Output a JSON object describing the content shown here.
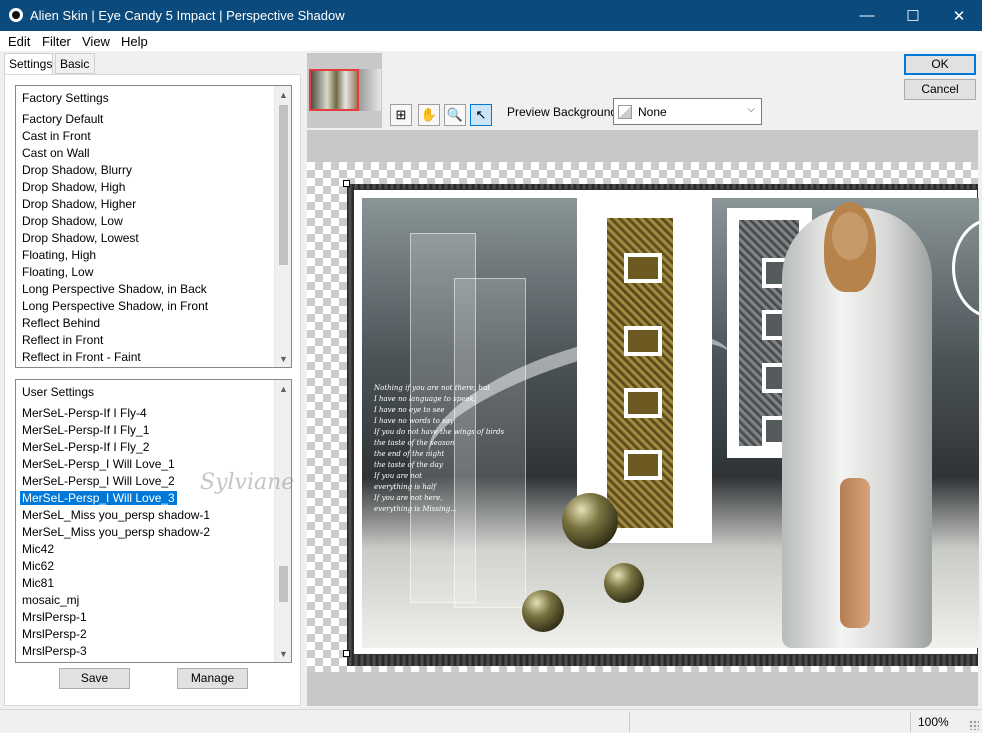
{
  "window": {
    "title": "Alien Skin | Eye Candy 5 Impact | Perspective Shadow",
    "minimize_glyph": "—",
    "maximize_glyph": "☐",
    "close_glyph": "✕"
  },
  "menu": [
    "Edit",
    "Filter",
    "View",
    "Help"
  ],
  "tabs": {
    "settings": "Settings",
    "basic": "Basic"
  },
  "factory_settings": {
    "header": "Factory Settings",
    "items": [
      "Factory Default",
      "Cast in Front",
      "Cast on Wall",
      "Drop Shadow, Blurry",
      "Drop Shadow, High",
      "Drop Shadow, Higher",
      "Drop Shadow, Low",
      "Drop Shadow, Lowest",
      "Floating, High",
      "Floating, Low",
      "Long Perspective Shadow, in Back",
      "Long Perspective Shadow, in Front",
      "Reflect Behind",
      "Reflect in Front",
      "Reflect in Front - Faint"
    ]
  },
  "user_settings": {
    "header": "User Settings",
    "selected_index": 5,
    "items": [
      "MerSeL-Persp-If I Fly-4",
      "MerSeL-Persp-If I Fly_1",
      "MerSeL-Persp-If I Fly_2",
      "MerSeL-Persp_I Will Love_1",
      "MerSeL-Persp_I Will Love_2",
      "MerSeL-Persp_I Will Love_3",
      "MerSeL_Miss you_persp shadow-1",
      "MerSeL_Miss you_persp shadow-2",
      "Mic42",
      "Mic62",
      "Mic81",
      "mosaic_mj",
      "MrslPersp-1",
      "MrslPersp-2",
      "MrslPersp-3"
    ]
  },
  "buttons": {
    "save": "Save",
    "manage": "Manage",
    "ok": "OK",
    "cancel": "Cancel"
  },
  "tools": {
    "navigator": "⊞",
    "hand": "✋",
    "zoom": "🔍",
    "pointer": "↖"
  },
  "preview_background": {
    "label": "Preview Background:",
    "value": "None",
    "chevron": "⌵"
  },
  "preview": {
    "poem_lines": [
      "Nothing if you are not there; but",
      "I have no language to speak,",
      "I have no eye to see",
      "I have no words to say",
      "If you do not have the wings of birds",
      "the taste of the season",
      "the end of the night",
      "the taste of the day",
      "If you are not",
      "everything is half",
      "If you are not here,",
      "everything is Missing..."
    ],
    "watermark": "Sylviane"
  },
  "status": {
    "zoom": "100%"
  },
  "colors": {
    "titlebar": "#0b4a7c",
    "selection": "#0078d7"
  }
}
